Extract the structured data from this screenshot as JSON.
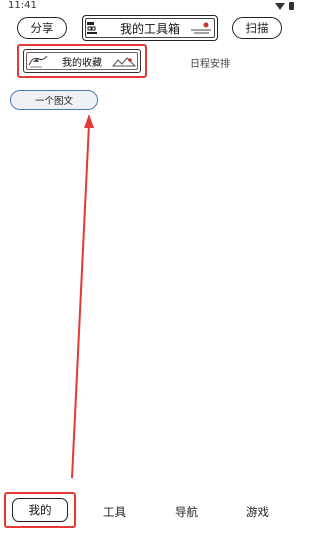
{
  "status_bar": {
    "time": "11:41",
    "icons": [
      "wifi-icon",
      "battery-icon"
    ]
  },
  "header": {
    "share_label": "分享",
    "title": "我的工具箱",
    "scan_label": "扫描"
  },
  "tabs": [
    {
      "label": "我的收藏",
      "active": true
    },
    {
      "label": "日程安排",
      "active": false
    }
  ],
  "content": {
    "items": [
      {
        "label": "一个图文"
      }
    ]
  },
  "bottom_nav": {
    "items": [
      {
        "label": "我的",
        "active": true
      },
      {
        "label": "工具",
        "active": false
      },
      {
        "label": "导航",
        "active": false
      },
      {
        "label": "游戏",
        "active": false
      }
    ]
  },
  "colors": {
    "highlight": "#e53935",
    "card_border": "#4a7bb7",
    "card_fill": "#eef2f7",
    "ink": "#222222"
  }
}
